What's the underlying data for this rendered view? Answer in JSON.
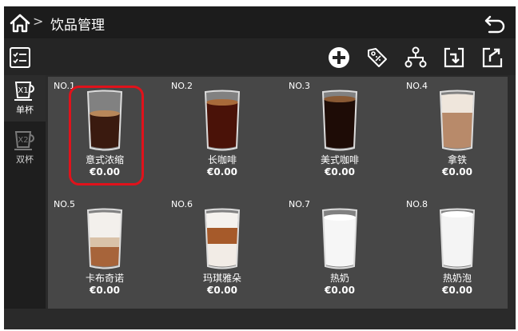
{
  "header": {
    "title": "饮品管理",
    "crumb_separator": ">"
  },
  "toolbar": {
    "actions": [
      "add-icon",
      "price-tag-icon",
      "hierarchy-icon",
      "import-icon",
      "export-icon"
    ]
  },
  "sidebar": {
    "items": [
      {
        "badge": "X1",
        "label": "单杯",
        "active": true
      },
      {
        "badge": "X2",
        "label": "双杯",
        "active": false
      }
    ]
  },
  "drinks": [
    {
      "no": "NO.1",
      "name": "意式浓缩",
      "price": "€0.00",
      "selected": true
    },
    {
      "no": "NO.2",
      "name": "长咖啡",
      "price": "€0.00"
    },
    {
      "no": "NO.3",
      "name": "美式咖啡",
      "price": "€0.00"
    },
    {
      "no": "NO.4",
      "name": "拿铁",
      "price": "€0.00"
    },
    {
      "no": "NO.5",
      "name": "卡布奇诺",
      "price": "€0.00"
    },
    {
      "no": "NO.6",
      "name": "玛琪雅朵",
      "price": "€0.00"
    },
    {
      "no": "NO.7",
      "name": "热奶",
      "price": "€0.00"
    },
    {
      "no": "NO.8",
      "name": "热奶泡",
      "price": "€0.00"
    }
  ],
  "colors": {
    "accent_selected": "#e0121b",
    "panel": "#474747",
    "titlebar": "#1c1c1c"
  }
}
